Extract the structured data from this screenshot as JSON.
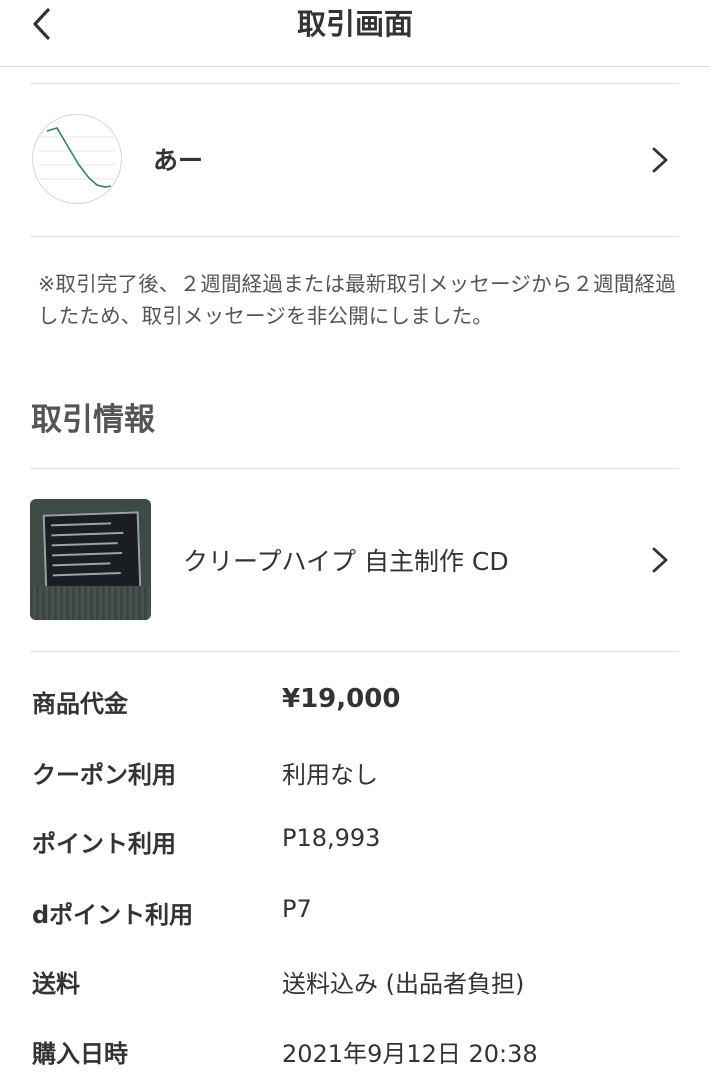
{
  "header": {
    "title": "取引画面",
    "back_icon": "chevron-left-icon"
  },
  "seller": {
    "name": "あー",
    "chevron_icon": "chevron-right-icon",
    "avatar_icon": "line-chart-avatar"
  },
  "notice": {
    "text": "※取引完了後、２週間経過または最新取引メッセージから２週間経過したため、取引メッセージを非公開にしました。"
  },
  "trade_info": {
    "section_title": "取引情報",
    "item": {
      "name": "クリープハイプ 自主制作 CD",
      "chevron_icon": "chevron-right-icon",
      "thumbnail": "cd-case-photo"
    },
    "rows": [
      {
        "label": "商品代金",
        "value": "¥19,000",
        "emphasis": true
      },
      {
        "label": "クーポン利用",
        "value": "利用なし",
        "emphasis": false
      },
      {
        "label": "ポイント利用",
        "value": "P18,993",
        "emphasis": false
      },
      {
        "label": "dポイント利用",
        "value": "P7",
        "emphasis": false
      },
      {
        "label": "送料",
        "value": "送料込み (出品者負担)",
        "emphasis": false
      },
      {
        "label": "購入日時",
        "value": "2021年9月12日 20:38",
        "emphasis": false
      }
    ]
  },
  "colors": {
    "text": "#333333",
    "subtext": "#555555",
    "divider": "#dcdcdc",
    "background": "#ffffff"
  }
}
